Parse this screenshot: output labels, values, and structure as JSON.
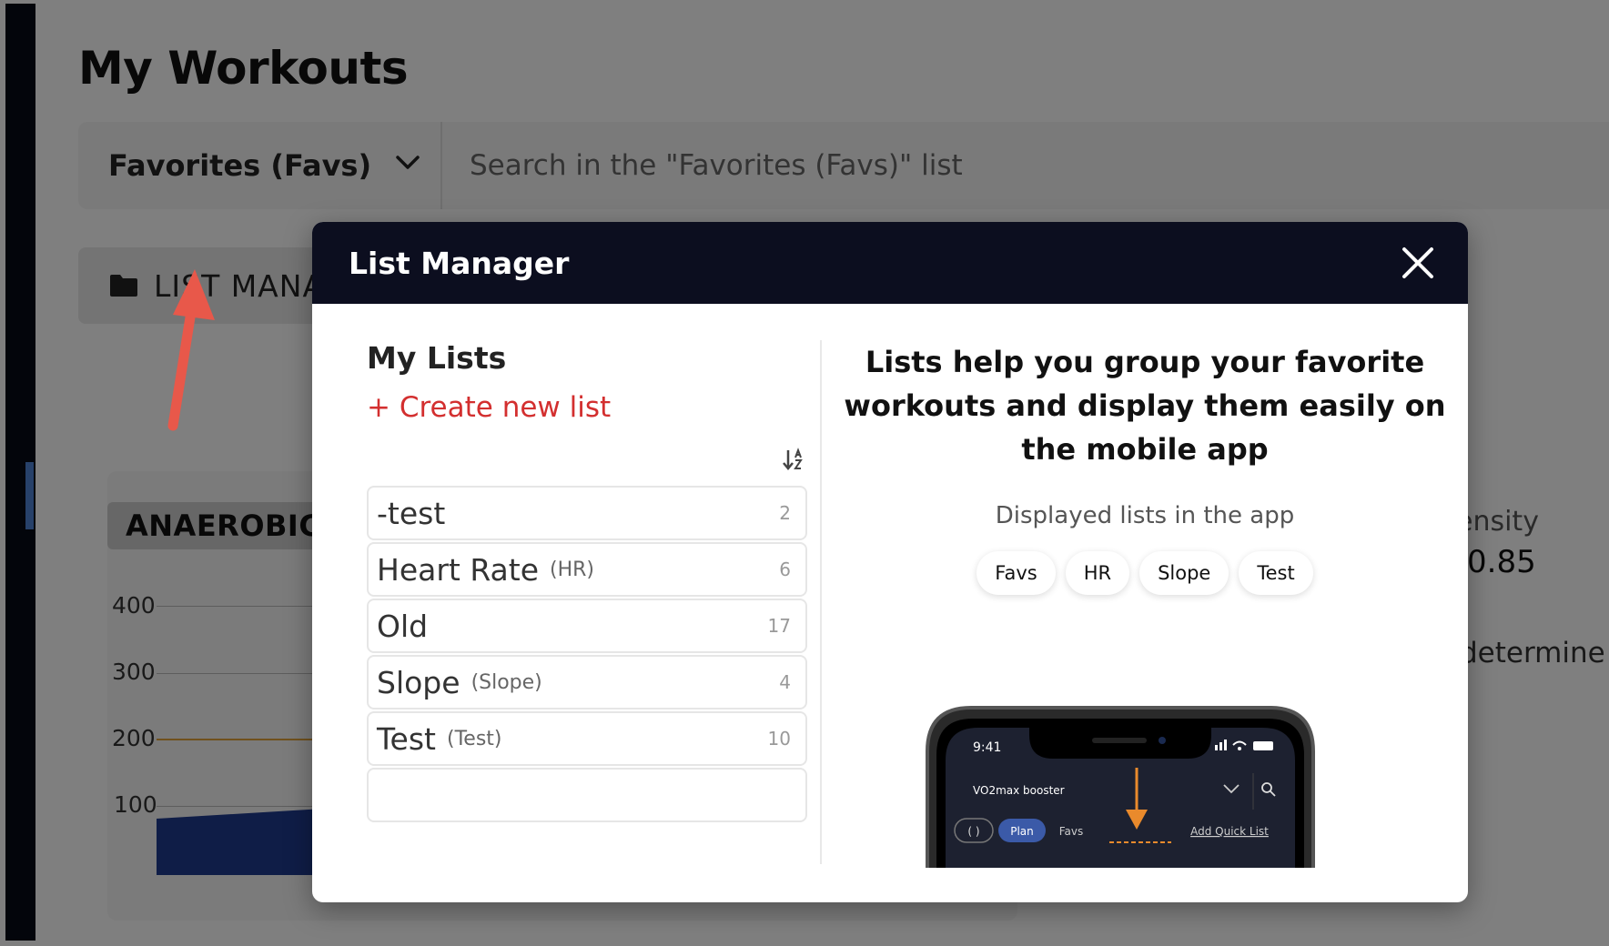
{
  "page": {
    "title": "My Workouts",
    "list_select": "Favorites (Favs)",
    "search_placeholder": "Search in the \"Favorites (Favs)\" list",
    "list_manager_button": "LIST MANAGER",
    "category_badge": "ANAEROBIC",
    "chart_axis": [
      "400",
      "300",
      "200",
      "100"
    ],
    "stat_label": "ensity",
    "stat_value": "0.85",
    "stat_desc": "determine y"
  },
  "modal": {
    "title": "List Manager",
    "my_lists_title": "My Lists",
    "create_new_list": "+ Create new list",
    "lists": [
      {
        "name": "-test",
        "tag": "",
        "count": "2"
      },
      {
        "name": "Heart Rate",
        "tag": "(HR)",
        "count": "6"
      },
      {
        "name": "Old",
        "tag": "",
        "count": "17"
      },
      {
        "name": "Slope",
        "tag": "(Slope)",
        "count": "4"
      },
      {
        "name": "Test",
        "tag": "(Test)",
        "count": "10"
      }
    ],
    "help_text": "Lists help you group your favorite workouts and display them easily on the mobile app",
    "displayed_lists_label": "Displayed lists in the app",
    "displayed_lists": [
      "Favs",
      "HR",
      "Slope",
      "Test"
    ],
    "phone": {
      "time": "9:41",
      "workout": "VO2max booster",
      "tab_plan": "Plan",
      "tab_favs": "Favs",
      "add_quick_list": "Add Quick List"
    }
  },
  "colors": {
    "modal_header": "#0c0e1f",
    "create_link": "#d32f2f",
    "annotation_arrow": "#e8584a",
    "phone_arrow": "#e98a2c",
    "chart_fill": "#1f3a8f",
    "reference_line": "#e0a33a"
  },
  "icons": {
    "close": "close-icon",
    "sort": "sort-alpha-icon",
    "folder": "folder-icon",
    "dropdown": "chevron-down-icon"
  }
}
